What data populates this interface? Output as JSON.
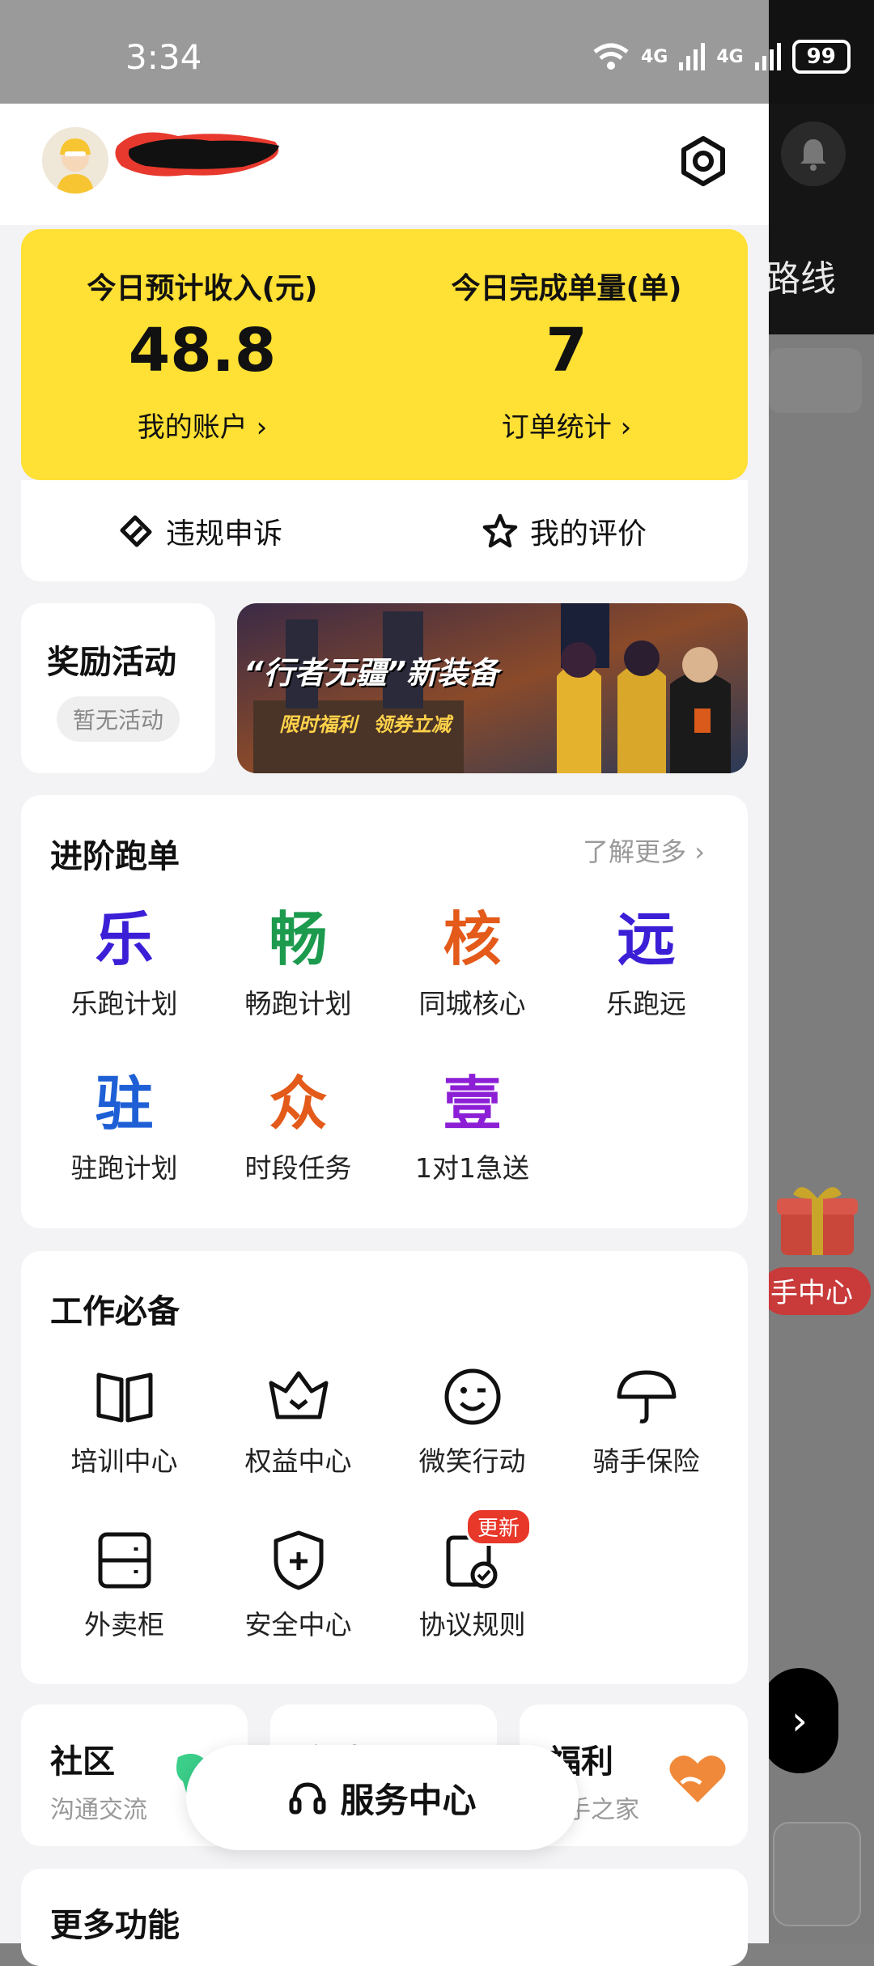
{
  "status_bar": {
    "time": "3:34",
    "network_1": "4G",
    "network_2": "4G",
    "battery": "99"
  },
  "background_app": {
    "route_label": "路线",
    "gift_label": "手中心"
  },
  "income_card": {
    "income_label": "今日预计收入(元)",
    "income_value": "48.8",
    "account_link": "我的账户",
    "orders_label": "今日完成单量(单)",
    "orders_value": "7",
    "stats_link": "订单统计"
  },
  "quick_actions": {
    "appeal": "违规申诉",
    "rating": "我的评价"
  },
  "rewards": {
    "title": "奖励活动",
    "empty": "暂无活动"
  },
  "banner": {
    "headline": "“行者无疆”新装备",
    "sub1": "限时福利",
    "sub2": "领券立减"
  },
  "advanced": {
    "title": "进阶跑单",
    "more": "了解更多",
    "items": [
      {
        "glyph": "乐",
        "label": "乐跑计划",
        "color": "#3b1fd6"
      },
      {
        "glyph": "畅",
        "label": "畅跑计划",
        "color": "#1c9a4e"
      },
      {
        "glyph": "核",
        "label": "同城核心",
        "color": "#e35a1a"
      },
      {
        "glyph": "远",
        "label": "乐跑远",
        "color": "#3b1fd6"
      },
      {
        "glyph": "驻",
        "label": "驻跑计划",
        "color": "#1e5fd6"
      },
      {
        "glyph": "众",
        "label": "时段任务",
        "color": "#e35a1a"
      },
      {
        "glyph": "壹",
        "label": "1对1急送",
        "color": "#8c1fd6"
      }
    ]
  },
  "essentials": {
    "title": "工作必备",
    "items": [
      {
        "label": "培训中心",
        "icon": "book-icon"
      },
      {
        "label": "权益中心",
        "icon": "crown-icon"
      },
      {
        "label": "微笑行动",
        "icon": "smile-icon"
      },
      {
        "label": "骑手保险",
        "icon": "umbrella-icon"
      },
      {
        "label": "外卖柜",
        "icon": "locker-icon"
      },
      {
        "label": "安全中心",
        "icon": "shield-icon"
      },
      {
        "label": "协议规则",
        "icon": "agreement-icon"
      }
    ],
    "badge": "更新"
  },
  "community": [
    {
      "title": "社区",
      "sub": "沟通交流"
    },
    {
      "title": "商城",
      "sub": ""
    },
    {
      "title": "福利",
      "sub": "手之家"
    }
  ],
  "service_center": "服务中心",
  "more_features": "更多功能"
}
